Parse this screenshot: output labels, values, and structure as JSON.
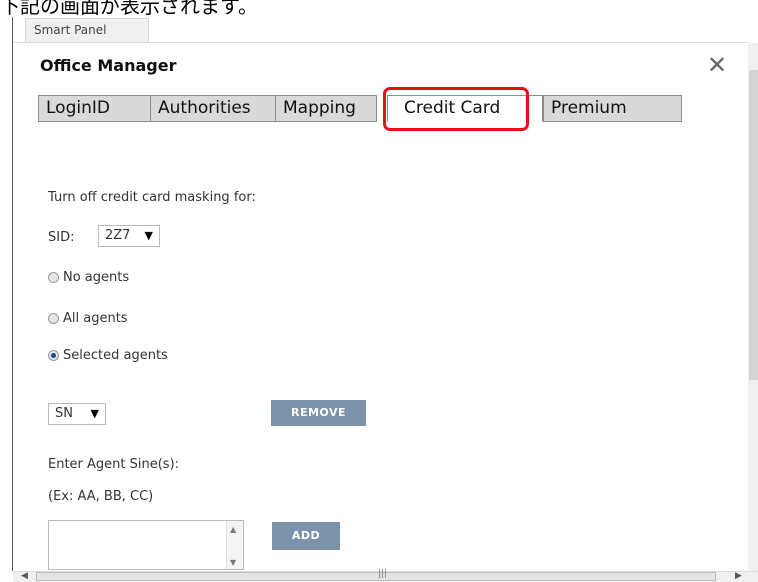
{
  "caption": "下記の画面が表示されます。",
  "panel": {
    "tab_label": "Smart Panel"
  },
  "dialog": {
    "title": "Office Manager",
    "close_glyph": "✕"
  },
  "tabs": [
    {
      "label": "LoginID",
      "active": false
    },
    {
      "label": "Authorities",
      "active": false
    },
    {
      "label": "Mapping",
      "active": false
    },
    {
      "label": "Credit Card",
      "active": true
    },
    {
      "label": "Premium",
      "active": false
    }
  ],
  "form": {
    "heading": "Turn off credit card masking for:",
    "sid_label": "SID:",
    "sid_value": "2Z7",
    "radios": [
      {
        "label": "No agents",
        "checked": false
      },
      {
        "label": "All agents",
        "checked": false
      },
      {
        "label": "Selected agents",
        "checked": true
      }
    ],
    "agent_select_value": "SN",
    "remove_label": "REMOVE",
    "enter_label": "Enter Agent Sine(s):",
    "example_label": "(Ex: AA, BB, CC)",
    "agent_input_value": "",
    "add_label": "ADD"
  },
  "colors": {
    "highlight": "#e8111a",
    "button": "#7c93ab",
    "tab_bg": "#d9d9d9"
  },
  "icons": {
    "close": "close-icon",
    "dropdown": "chevron-down-icon"
  }
}
